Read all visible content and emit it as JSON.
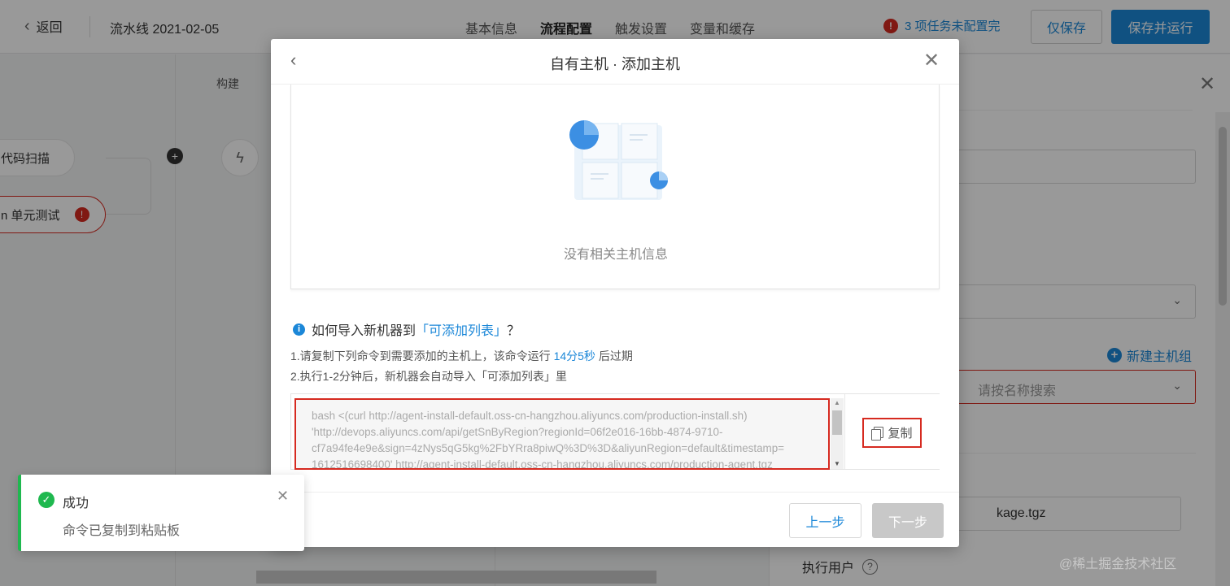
{
  "topbar": {
    "back_label": "返回",
    "pipeline_title": "流水线 2021-02-05",
    "tabs": [
      {
        "label": "基本信息"
      },
      {
        "label": "流程配置",
        "active": true
      },
      {
        "label": "触发设置"
      },
      {
        "label": "变量和缓存"
      }
    ],
    "warning_text": "3 项任务未配置完",
    "save_label": "仅保存",
    "save_run_label": "保存并运行"
  },
  "canvas": {
    "stage_label": "构建",
    "node_scan": "代码扫描",
    "node_test": "n 单元测试"
  },
  "panel": {
    "new_group_label": "新建主机组",
    "group_placeholder": "请按名称搜索",
    "package_value": "kage.tgz",
    "exec_user_label": "执行用户"
  },
  "modal": {
    "title": "自有主机 · 添加主机",
    "empty_text": "没有相关主机信息",
    "howto_prefix": "如何导入新机器到",
    "howto_link": "「可添加列表」",
    "howto_suffix": "？",
    "step1_prefix": "1.请复制下列命令到需要添加的主机上，该命令运行",
    "step1_time": "14分5秒",
    "step1_suffix": "后过期",
    "step2": "2.执行1-2分钟后，新机器会自动导入「可添加列表」里",
    "command_lines": [
      "bash <(curl http://agent-install-default.oss-cn-hangzhou.aliyuncs.com/production-install.sh)",
      "'http://devops.aliyuncs.com/api/getSnByRegion?regionId=06f2e016-16bb-4874-9710-",
      "cf7a94fe4e9e&sign=4zNys5qG5kg%2FbYRra8piwQ%3D%3D&aliyunRegion=default&timestamp=",
      "1612516698400' http://agent-install-default.oss-cn-hangzhou.aliyuncs.com/production-agent.tgz"
    ],
    "copy_label": "复制",
    "prev_label": "上一步",
    "next_label": "下一步"
  },
  "toast": {
    "title": "成功",
    "message": "命令已复制到粘贴板"
  },
  "watermark": "@稀土掘金技术社区",
  "colors": {
    "accent": "#1b87d8",
    "error": "#d62a20",
    "success": "#1fb84f"
  }
}
